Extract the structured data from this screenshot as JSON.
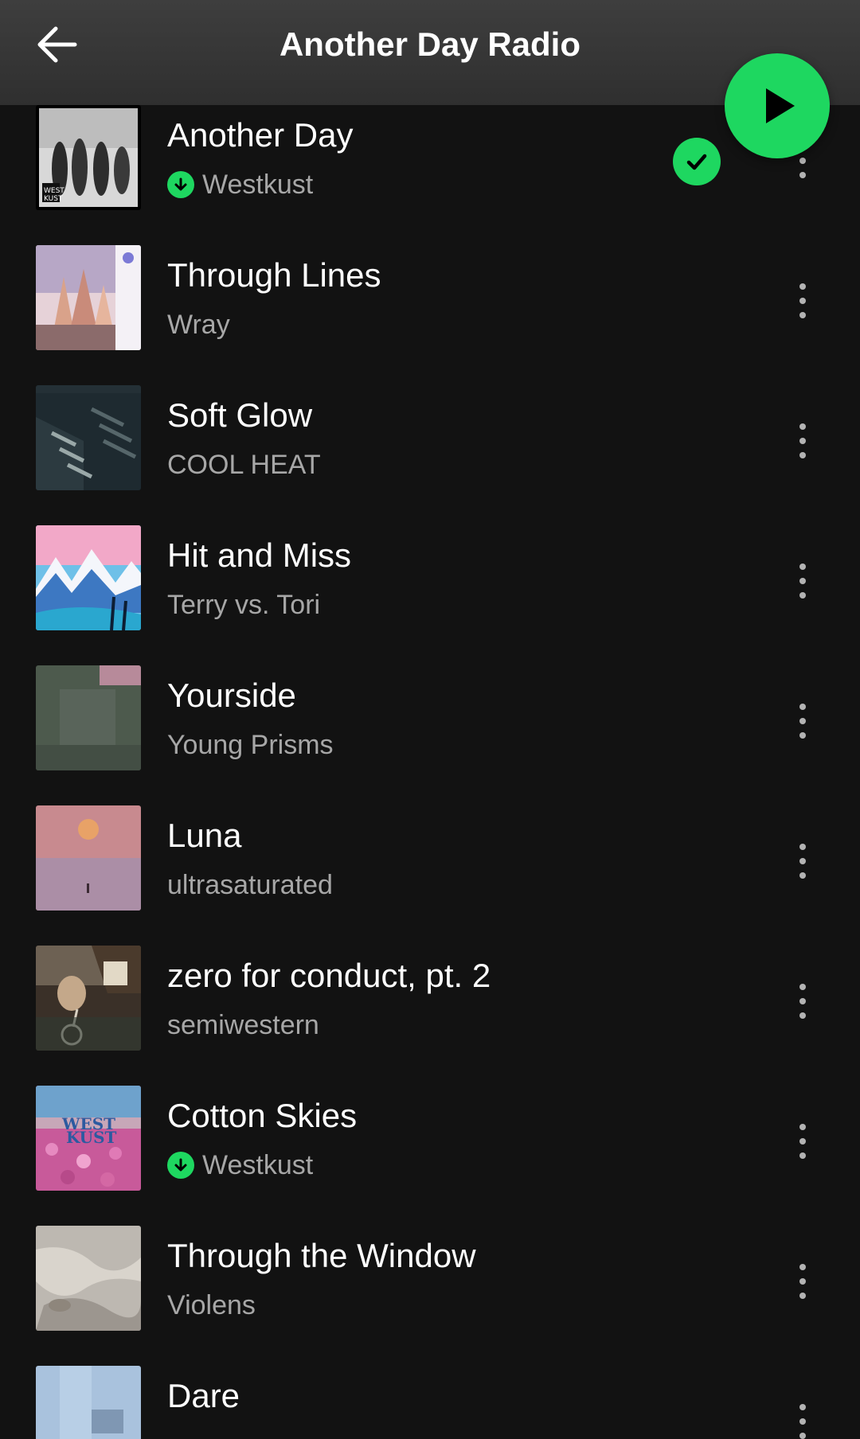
{
  "colors": {
    "accent": "#1ed760",
    "background": "#121212",
    "header": "#353535",
    "title_text": "#ffffff",
    "subtitle_text": "#a7a7a7"
  },
  "header": {
    "title": "Another Day Radio",
    "back_icon": "arrow-left-icon",
    "play_icon": "play-icon"
  },
  "tracks": [
    {
      "title": "Another Day",
      "artist": "Westkust",
      "downloaded": true,
      "liked": true
    },
    {
      "title": "Through Lines",
      "artist": "Wray",
      "downloaded": false
    },
    {
      "title": "Soft Glow",
      "artist": "COOL HEAT",
      "downloaded": false
    },
    {
      "title": "Hit and Miss",
      "artist": "Terry vs. Tori",
      "downloaded": false
    },
    {
      "title": "Yourside",
      "artist": "Young Prisms",
      "downloaded": false
    },
    {
      "title": "Luna",
      "artist": "ultrasaturated",
      "downloaded": false
    },
    {
      "title": "zero for conduct, pt. 2",
      "artist": "semiwestern",
      "downloaded": false
    },
    {
      "title": "Cotton Skies",
      "artist": "Westkust",
      "downloaded": true
    },
    {
      "title": "Through the Window",
      "artist": "Violens",
      "downloaded": false
    },
    {
      "title": "Dare",
      "artist": "",
      "downloaded": false
    }
  ]
}
